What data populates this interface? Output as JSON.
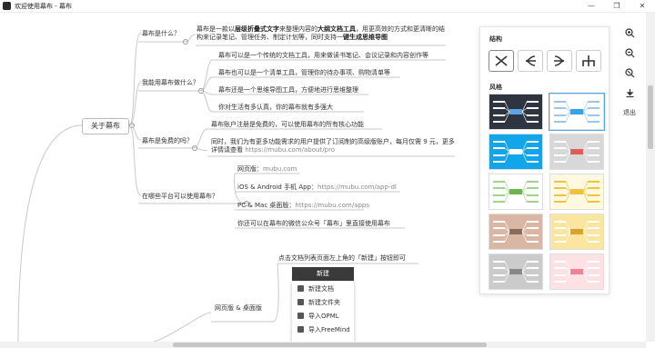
{
  "window": {
    "title": "欢迎使用幕布 - 幕布",
    "controls": [
      "—",
      "❐",
      "✕"
    ]
  },
  "mindmap": {
    "root": "关于幕布",
    "branches": [
      {
        "label": "幕布是什么？"
      },
      {
        "label": "我能用幕布做什么？"
      },
      {
        "label": "幕布是免费的吗？"
      },
      {
        "label": "在哪些平台可以使用幕布？"
      }
    ],
    "what_is": {
      "p1": "幕布是一款以",
      "b1": "层级折叠式文字",
      "p2": "来整理内容的",
      "b2": "大纲文档工具",
      "p3": "，用更高效的方式和更清晰的结构来记录笔记、管理任务、制定计划等，同时支持一",
      "b3": "键生成思维导图"
    },
    "uses": [
      "幕布可以是一个传统的文档工具，用来做读书笔记、会议记录和内容创作等",
      "幕布也可以是一个清单工具，管理你的待办事项、购物清单等",
      "幕布还是一个思维导图工具，方便地进行思维整理",
      "你对生活有多认真，你的幕布就有多强大"
    ],
    "free": [
      "幕布账户注册是免费的，可以使用幕布的所有核心功能",
      "同时，我们为有更多功能需求的用户提供了订阅制的高级版账户，每月仅需 9 元，更多详情请查看",
      "https://mubu.com/about/pro"
    ],
    "platforms": {
      "web_label": "网页版：",
      "web_link": "mubu.com",
      "mobile_label": "iOS & Android 手机 App：",
      "mobile_link": "https://mubu.com/app-dl",
      "desktop_label": "PC & Mac 桌面版：",
      "desktop_link": "https://mubu.com/apps",
      "wechat": "你还可以在幕布的微信公众号「幕布」里直接使用幕布"
    },
    "lower": {
      "hint": "点击文档列表页面左上角的「新建」按钮即可",
      "branch": "网页版 & 桌面版"
    }
  },
  "new_menu": {
    "button": "新建",
    "items": [
      "新建文档",
      "新建文件夹",
      "导入OPML",
      "导入FreeMind"
    ]
  },
  "style_panel": {
    "structure_title": "结构",
    "style_title": "风格",
    "themes": [
      {
        "bg": "#2e3440",
        "accent": "#ffffff",
        "center": "#5ea3e6"
      },
      {
        "bg": "#ffffff",
        "accent": "#9bc7ee",
        "center": "#37a2e8"
      },
      {
        "bg": "#11a6ec",
        "accent": "#ffffff",
        "center": "#ffffff"
      },
      {
        "bg": "#d8d8d8",
        "accent": "#ffffff",
        "center": "#e35b55"
      },
      {
        "bg": "#ffffff",
        "accent": "#9fd48b",
        "center": "#68b84a"
      },
      {
        "bg": "#fff9e0",
        "accent": "#f3c23c",
        "center": "#f3c23c"
      },
      {
        "bg": "#d9b7a4",
        "accent": "#ffffff",
        "center": "#8a6a58"
      },
      {
        "bg": "#fbe6a1",
        "accent": "#ffffff",
        "center": "#d9a228"
      },
      {
        "bg": "#cbcbcb",
        "accent": "#ffffff",
        "center": "#888888"
      },
      {
        "bg": "#fde1e4",
        "accent": "#ffffff",
        "center": "#ee8494"
      }
    ]
  },
  "toolbar": {
    "exit": "退出"
  }
}
